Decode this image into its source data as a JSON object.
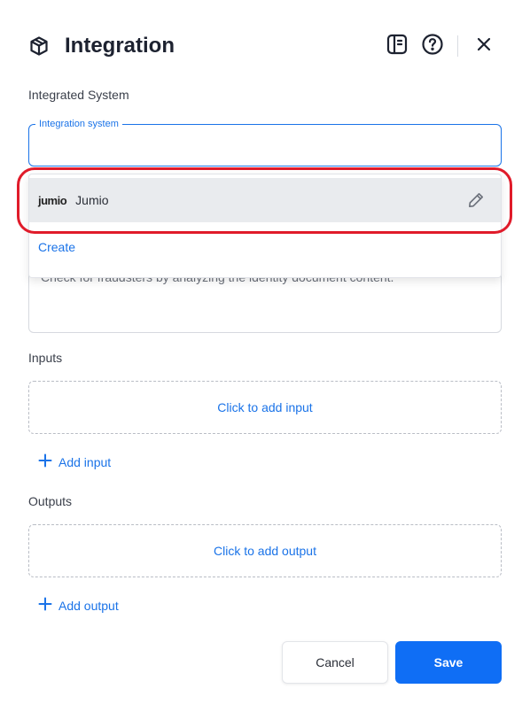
{
  "header": {
    "title": "Integration",
    "title_icon": "cube-icon",
    "actions": [
      "docs-icon",
      "help-icon",
      "close-icon"
    ]
  },
  "integrated_system": {
    "section_label": "Integrated System",
    "field_label": "Integration system",
    "value": "",
    "dropdown": {
      "options": [
        {
          "logo": "jumio",
          "label": "Jumio",
          "action_icon": "pencil-icon"
        }
      ],
      "create_label": "Create"
    }
  },
  "description": {
    "text": "Check for fraudsters by analyzing the identity document content."
  },
  "inputs": {
    "section_label": "Inputs",
    "placeholder": "Click to add input",
    "add_label": "Add input"
  },
  "outputs": {
    "section_label": "Outputs",
    "placeholder": "Click to add output",
    "add_label": "Add output"
  },
  "footer": {
    "cancel_label": "Cancel",
    "save_label": "Save"
  },
  "colors": {
    "accent": "#1a73e8",
    "primary_button": "#0f6ef5",
    "highlight": "#e01b2a"
  }
}
